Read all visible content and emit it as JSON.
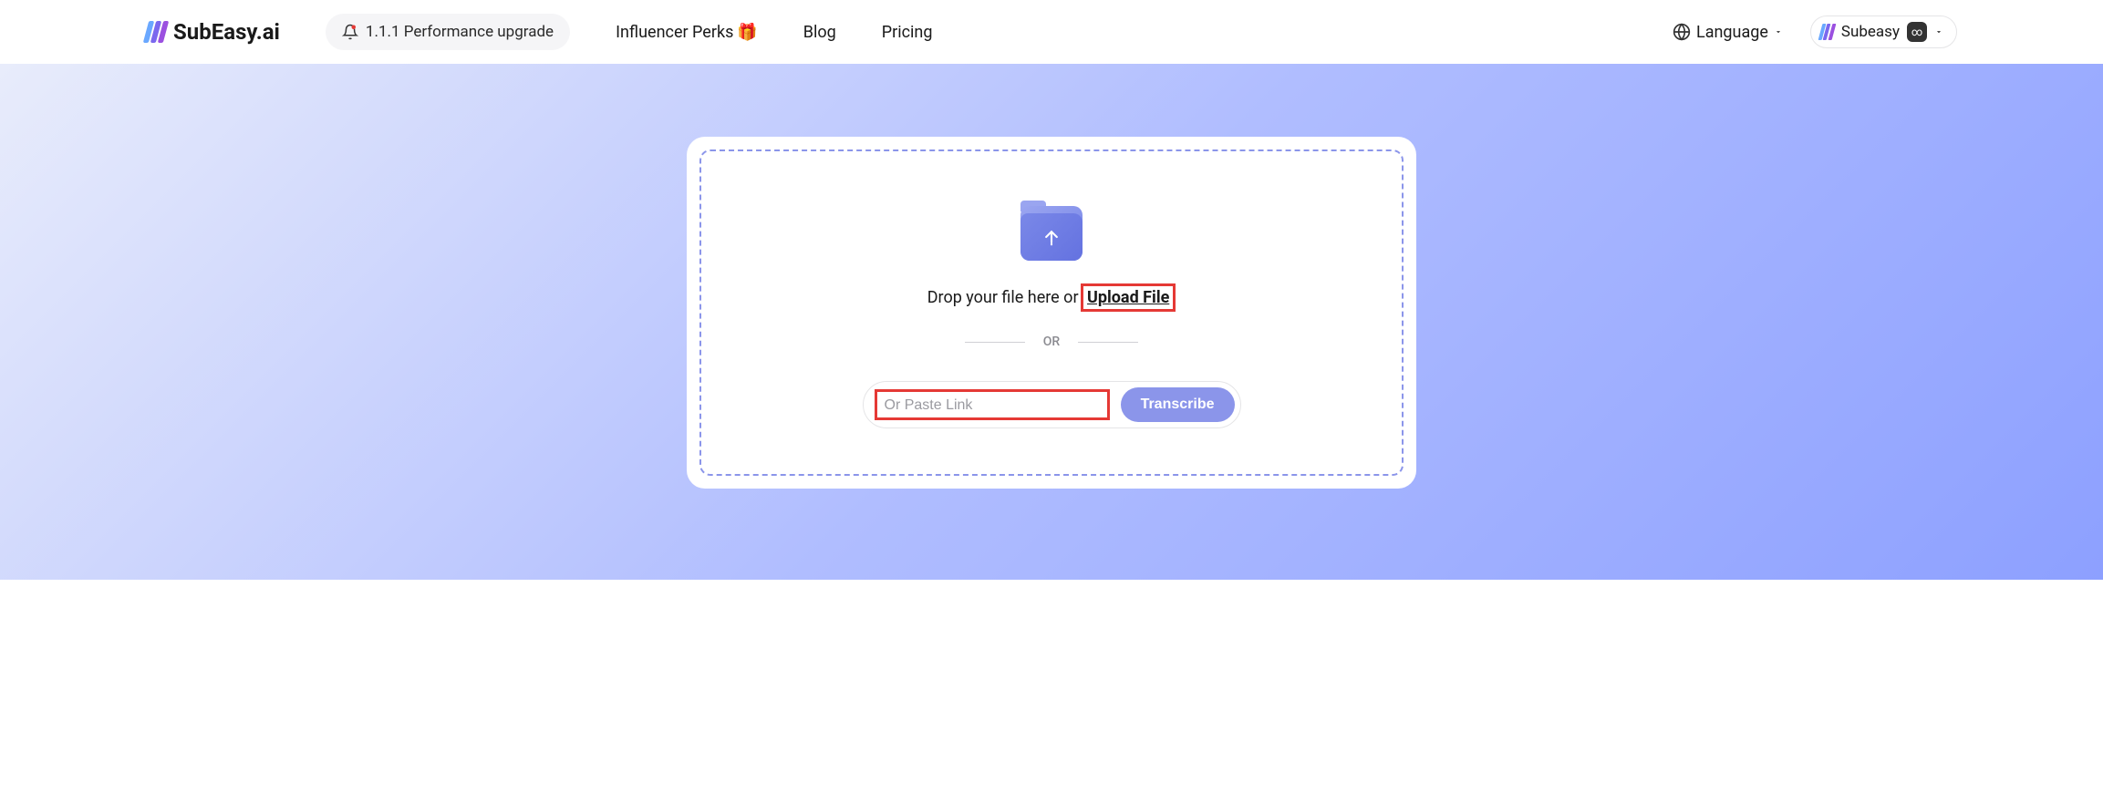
{
  "header": {
    "brand": "SubEasy.ai",
    "upgrade_label": "1.1.1 Performance upgrade",
    "nav": {
      "influencer_perks": "Influencer Perks",
      "blog": "Blog",
      "pricing": "Pricing"
    },
    "language_label": "Language",
    "user_label": "Subeasy"
  },
  "upload": {
    "drop_prefix": "Drop your file here or ",
    "upload_link": "Upload File",
    "divider": "OR",
    "paste_placeholder": "Or Paste Link",
    "transcribe_label": "Transcribe"
  }
}
